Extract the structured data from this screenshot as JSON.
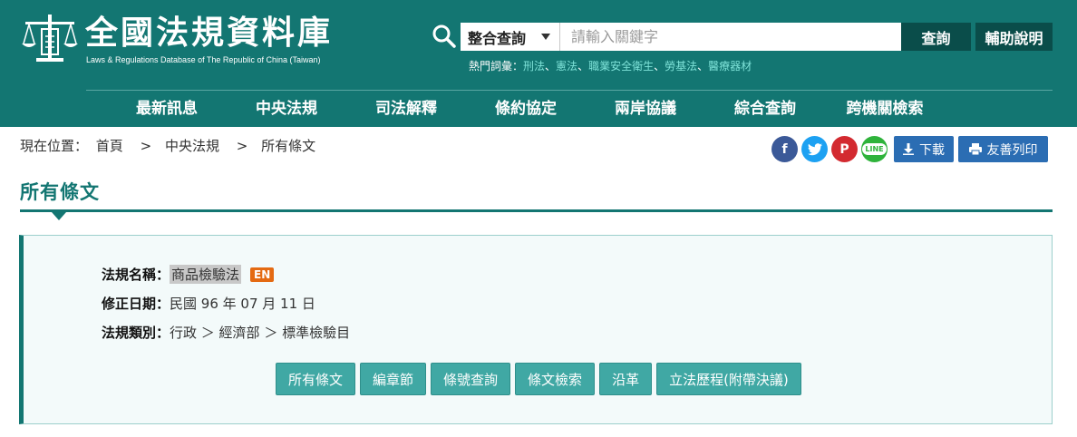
{
  "site": {
    "title": "全國法規資料庫",
    "subtitle": "Laws & Regulations Database of The Republic of China (Taiwan)"
  },
  "search": {
    "scope": "整合查詢",
    "placeholder": "請輸入關鍵字",
    "submit_label": "查詢",
    "help_label": "輔助說明"
  },
  "hot_keywords": {
    "label": "熱門詞彙：",
    "items": [
      "刑法",
      "憲法",
      "職業安全衛生",
      "勞基法",
      "醫療器材"
    ]
  },
  "nav": [
    "最新訊息",
    "中央法規",
    "司法解釋",
    "條約協定",
    "兩岸協議",
    "綜合查詢",
    "跨機關檢索"
  ],
  "breadcrumb": {
    "prefix": "現在位置：",
    "items": [
      "首頁",
      "中央法規",
      "所有條文"
    ],
    "separator": ">"
  },
  "share": {
    "facebook": "f",
    "pinterest": "P",
    "line": "LINE"
  },
  "actions": {
    "download": "下載",
    "print": "友善列印"
  },
  "page_title": "所有條文",
  "law": {
    "name_label": "法規名稱：",
    "name": "商品檢驗法",
    "en_badge": "EN",
    "date_label": "修正日期：",
    "date": "民國 96 年 07 月 11 日",
    "category_label": "法規類別：",
    "category": "行政 ＞ 經濟部 ＞ 標準檢驗目"
  },
  "tabs": [
    "所有條文",
    "編章節",
    "條號查詢",
    "條文檢索",
    "沿革",
    "立法歷程(附帶決議)"
  ],
  "colors": {
    "header": "#137672",
    "dark_button": "#0a4d4a",
    "tab": "#40a8a4",
    "action_button": "#2b6db3",
    "en_badge": "#e46a12"
  }
}
